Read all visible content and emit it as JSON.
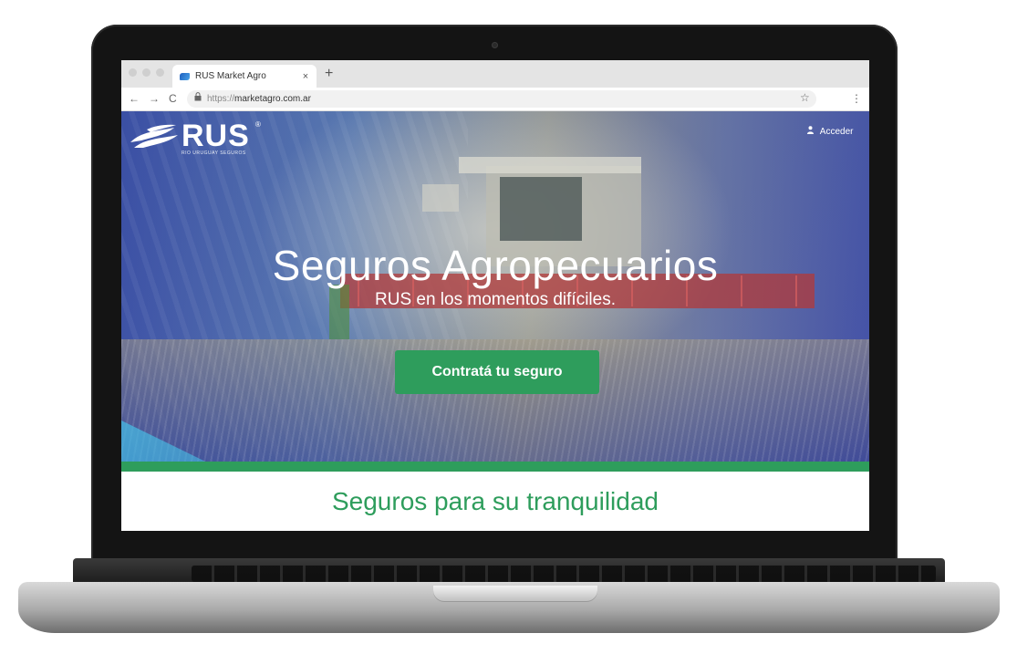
{
  "browser": {
    "tab_title": "RUS Market Agro",
    "tab_close": "×",
    "new_tab": "+",
    "nav_back": "←",
    "nav_forward": "→",
    "nav_reload": "C",
    "lock_icon": "🔒",
    "url_protocol": "https://",
    "url_host": "marketagro.com.ar",
    "bookmark_star": "☆",
    "menu": "⋮"
  },
  "header": {
    "logo_text": "RUS",
    "logo_registered": "®",
    "logo_subtitle": "RIO URUGUAY SEGUROS",
    "login_label": "Acceder",
    "login_icon": "user-icon"
  },
  "hero": {
    "title": "Seguros Agropecuarios",
    "subtitle": "RUS en los momentos difíciles.",
    "cta_label": "Contratá tu seguro"
  },
  "section": {
    "title": "Seguros para su tranquilidad"
  },
  "colors": {
    "accent_green": "#2e9d5c",
    "brand_blue": "#3c4fa6",
    "white": "#ffffff"
  }
}
